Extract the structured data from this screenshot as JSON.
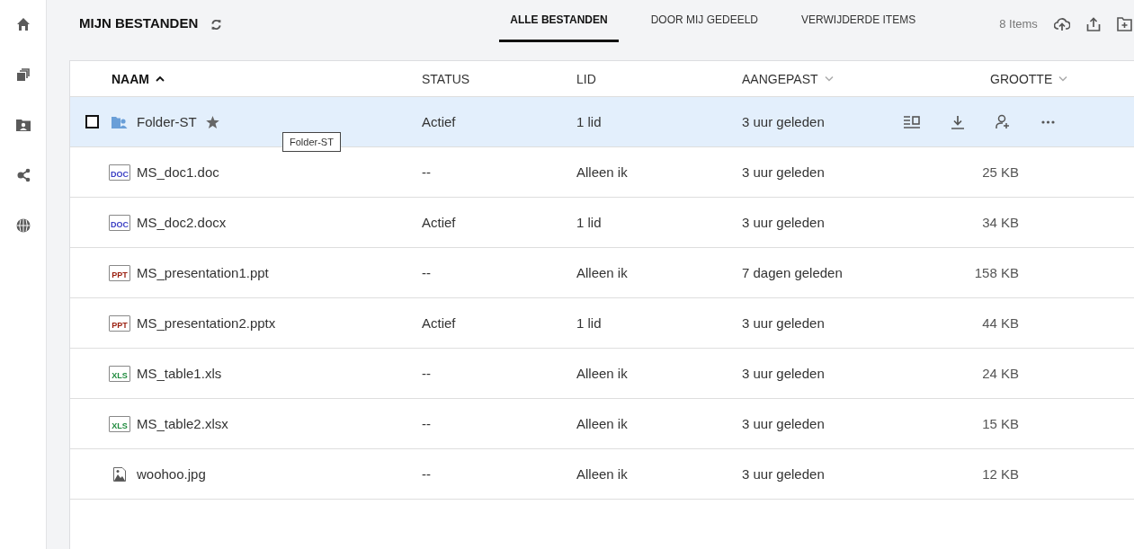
{
  "sidebar": {
    "items": [
      {
        "kind": "home",
        "selected": false
      },
      {
        "kind": "files",
        "selected": false
      },
      {
        "kind": "network",
        "selected": false
      },
      {
        "kind": "shared",
        "selected": false
      },
      {
        "kind": "globe",
        "selected": false
      }
    ]
  },
  "header": {
    "title": "MIJN BESTANDEN",
    "count": "8 Items"
  },
  "tabs": [
    {
      "label": "ALLE BESTANDEN",
      "selected": true
    },
    {
      "label": "DOOR MIJ GEDEELD",
      "selected": false
    },
    {
      "label": "VERWIJDERDE ITEMS",
      "selected": false
    }
  ],
  "table": {
    "columns": [
      {
        "label": "NAAM",
        "sorted": true,
        "has_menu": false
      },
      {
        "label": "STATUS",
        "sorted": false,
        "has_menu": false
      },
      {
        "label": "LID",
        "sorted": false,
        "has_menu": false
      },
      {
        "label": "AANGEPAST",
        "sorted": false,
        "has_menu": true
      },
      {
        "label": "GROOTTE",
        "sorted": false,
        "has_menu": true
      }
    ],
    "rows": [
      {
        "kind": "folder",
        "name": "Folder-ST",
        "starred": true,
        "selected": true,
        "checked": false,
        "status": "Actief",
        "member": "1 lid",
        "modified": "3 uur geleden"
      },
      {
        "kind": "doc",
        "icon_label": "DOC",
        "name": "MS_doc1.doc",
        "starred": false,
        "selected": false,
        "checked": false,
        "status": "--",
        "member": "Alleen ik",
        "modified": "3 uur geleden",
        "size": "25 KB"
      },
      {
        "kind": "doc",
        "icon_label": "DOC",
        "name": "MS_doc2.docx",
        "starred": false,
        "selected": false,
        "checked": false,
        "status": "Actief",
        "member": "1 lid",
        "modified": "3 uur geleden",
        "size": "34 KB"
      },
      {
        "kind": "ppt",
        "icon_label": "PPT",
        "name": "MS_presentation1.ppt",
        "starred": false,
        "selected": false,
        "checked": false,
        "status": "--",
        "member": "Alleen ik",
        "modified": "7 dagen geleden",
        "size": "158 KB"
      },
      {
        "kind": "ppt",
        "icon_label": "PPT",
        "name": "MS_presentation2.pptx",
        "starred": false,
        "selected": false,
        "checked": false,
        "status": "Actief",
        "member": "1 lid",
        "modified": "3 uur geleden",
        "size": "44 KB"
      },
      {
        "kind": "xls",
        "icon_label": "XLS",
        "name": "MS_table1.xls",
        "starred": false,
        "selected": false,
        "checked": false,
        "status": "--",
        "member": "Alleen ik",
        "modified": "3 uur geleden",
        "size": "24 KB"
      },
      {
        "kind": "xls",
        "icon_label": "XLS",
        "name": "MS_table2.xlsx",
        "starred": false,
        "selected": false,
        "checked": false,
        "status": "--",
        "member": "Alleen ik",
        "modified": "3 uur geleden",
        "size": "15 KB"
      },
      {
        "kind": "image",
        "name": "woohoo.jpg",
        "starred": false,
        "selected": false,
        "checked": false,
        "status": "--",
        "member": "Alleen ik",
        "modified": "3 uur geleden",
        "size": "12 KB"
      }
    ]
  },
  "tooltip": {
    "text": "Folder-ST"
  }
}
